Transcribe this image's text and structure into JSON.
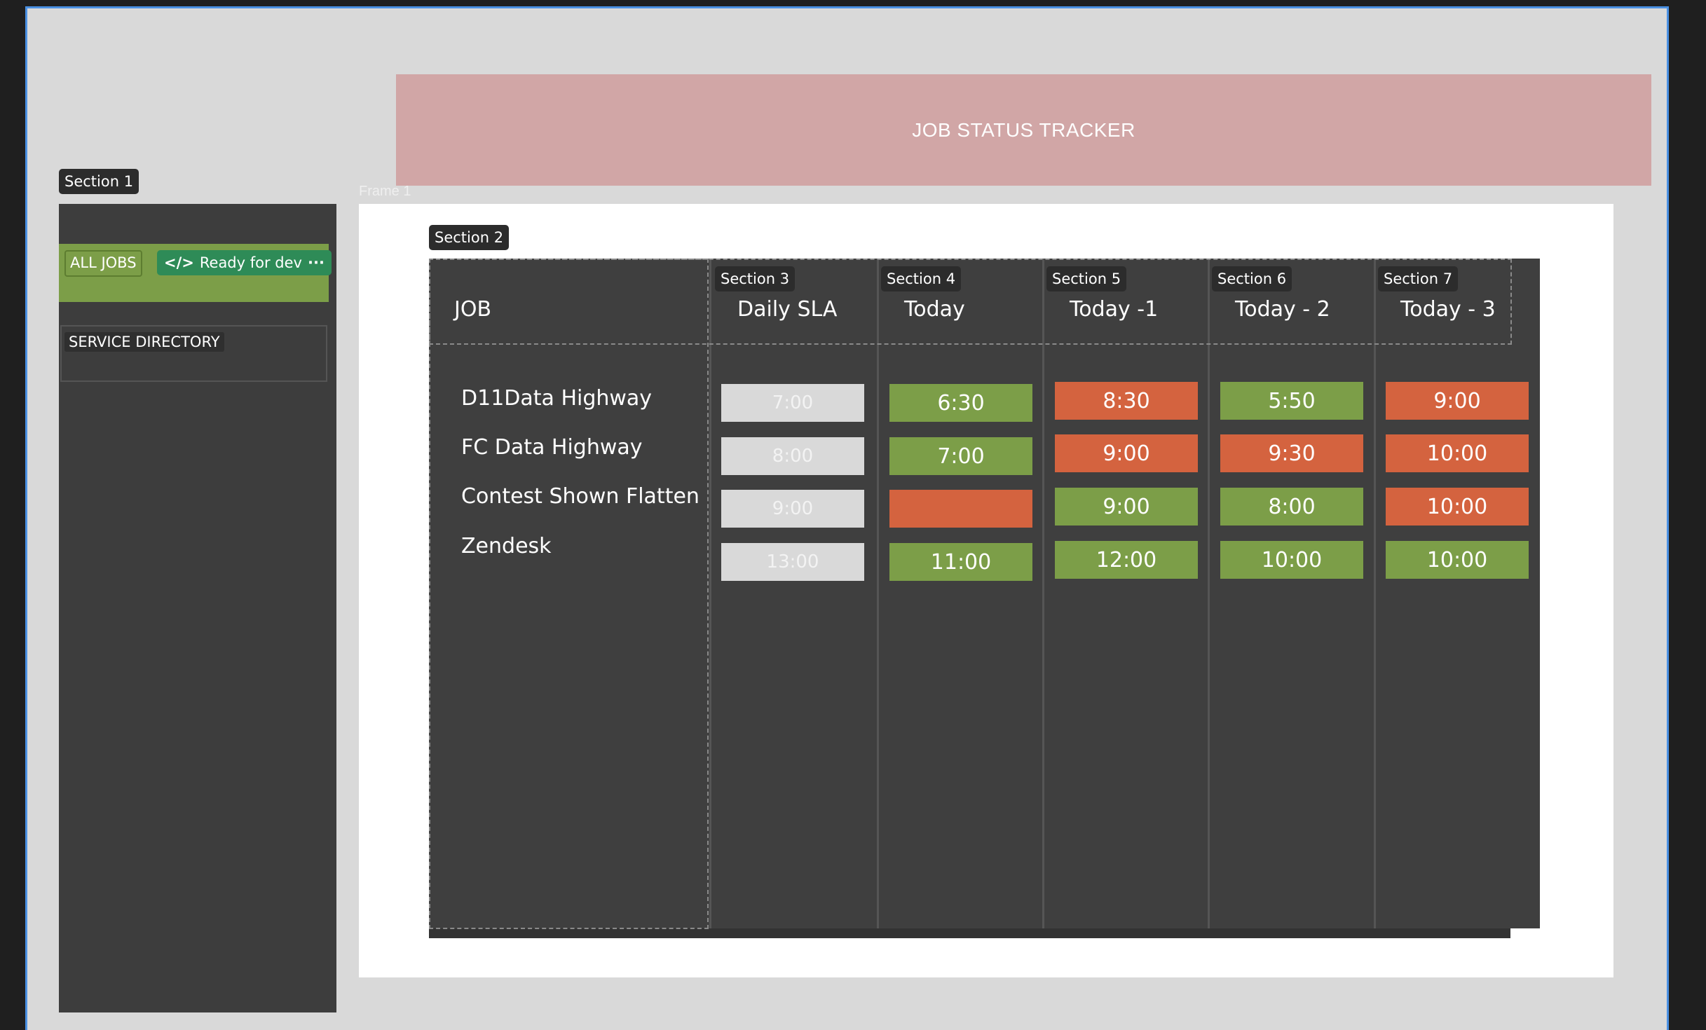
{
  "page": {
    "title": "JOB STATUS TRACKER",
    "frame_label": "Frame 1",
    "colors": {
      "green": "#7c9e48",
      "red": "#d4633f",
      "sla_gray": "#d9d9d9",
      "banner": "#d1a6a6"
    }
  },
  "sidebar": {
    "section_label": "Section 1",
    "all_jobs": "ALL JOBS",
    "ready_for_dev": "Ready for dev",
    "ready_icon": "code-icon",
    "more_icon": "ellipsis-icon",
    "service_directory": "SERVICE DIRECTORY"
  },
  "table": {
    "section_label": "Section 2",
    "job_header": "JOB",
    "columns": [
      {
        "section": "Section 3",
        "label": "Daily SLA"
      },
      {
        "section": "Section 4",
        "label": "Today"
      },
      {
        "section": "Section 5",
        "label": "Today -1"
      },
      {
        "section": "Section 6",
        "label": "Today - 2"
      },
      {
        "section": "Section 7",
        "label": "Today - 3"
      }
    ],
    "jobs": [
      "D11Data Highway",
      "FC Data Highway",
      "Contest Shown Flatten",
      "Zendesk"
    ],
    "sla": [
      "7:00",
      "8:00",
      "9:00",
      "13:00"
    ],
    "today": [
      {
        "value": "6:30",
        "status": "green"
      },
      {
        "value": "7:00",
        "status": "green"
      },
      {
        "value": "",
        "status": "red"
      },
      {
        "value": "11:00",
        "status": "green"
      }
    ],
    "today_minus_1": [
      {
        "value": "8:30",
        "status": "red"
      },
      {
        "value": "9:00",
        "status": "red"
      },
      {
        "value": "9:00",
        "status": "green"
      },
      {
        "value": "12:00",
        "status": "green"
      }
    ],
    "today_minus_2": [
      {
        "value": "5:50",
        "status": "green"
      },
      {
        "value": "9:30",
        "status": "red"
      },
      {
        "value": "8:00",
        "status": "green"
      },
      {
        "value": "10:00",
        "status": "green"
      }
    ],
    "today_minus_3": [
      {
        "value": "9:00",
        "status": "red"
      },
      {
        "value": "10:00",
        "status": "red"
      },
      {
        "value": "10:00",
        "status": "red"
      },
      {
        "value": "10:00",
        "status": "green"
      }
    ]
  }
}
